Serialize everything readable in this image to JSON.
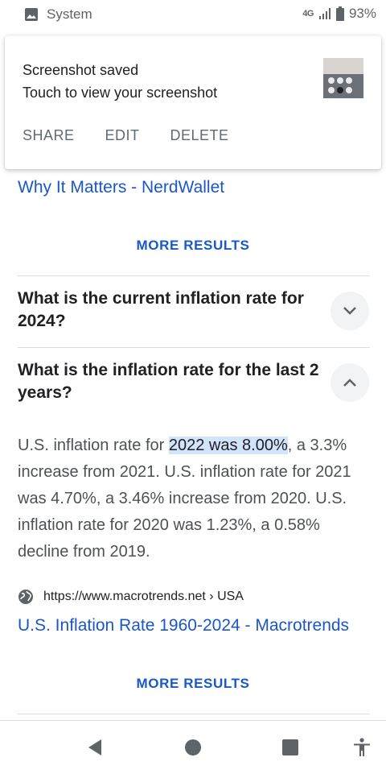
{
  "status_bar": {
    "app_label": "System",
    "network": "4G",
    "battery": "93%"
  },
  "notification": {
    "title": "Screenshot saved",
    "text": "Touch to view your screenshot",
    "actions": [
      "SHARE",
      "EDIT",
      "DELETE"
    ]
  },
  "content": {
    "prev_link": "Why It Matters - NerdWallet",
    "more_results_1": "MORE RESULTS",
    "faq": [
      {
        "question": "What is the current inflation rate for 2024?",
        "expanded": false
      },
      {
        "question": "What is the inflation rate for the last 2 years?",
        "expanded": true
      }
    ],
    "answer": {
      "before": "U.S. inflation rate for ",
      "highlight": "2022 was 8.00%",
      "after": ", a 3.3% increase from 2021. U.S. inflation rate for 2021 was 4.70%, a 3.46% increase from 2020. U.S. inflation rate for 2020 was 1.23%, a 0.58% decline from 2019."
    },
    "source_url": "https://www.macrotrends.net › USA",
    "source_title": "U.S. Inflation Rate 1960-2024 - Macrotrends",
    "more_results_2": "MORE RESULTS"
  },
  "colors": {
    "link": "#1a57c9",
    "highlight": "#d2e3fc"
  },
  "nav_icons": [
    "back-icon",
    "home-icon",
    "recents-icon",
    "accessibility-icon"
  ]
}
